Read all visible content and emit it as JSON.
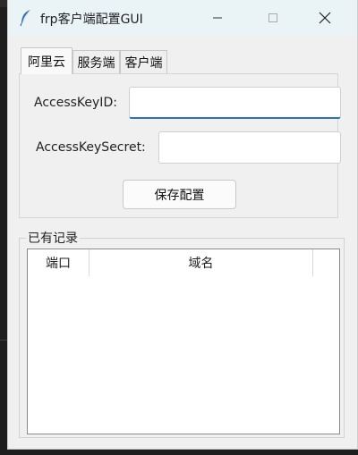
{
  "window": {
    "title": "frp客户端配置GUI",
    "icon": "feather-icon"
  },
  "tabs": [
    {
      "label": "阿里云",
      "active": true
    },
    {
      "label": "服务端",
      "active": false
    },
    {
      "label": "客户端",
      "active": false
    }
  ],
  "form": {
    "access_key_id_label": "AccessKeyID:",
    "access_key_id_value": "",
    "access_key_secret_label": "AccessKeySecret:",
    "access_key_secret_value": "",
    "save_button": "保存配置"
  },
  "records": {
    "group_title": "已有记录",
    "columns": [
      "端口",
      "域名"
    ],
    "rows": []
  },
  "colors": {
    "titlebar": "#eaf4f7",
    "window_bg": "#f0f0f0",
    "focus_accent": "#2d6fbf"
  }
}
